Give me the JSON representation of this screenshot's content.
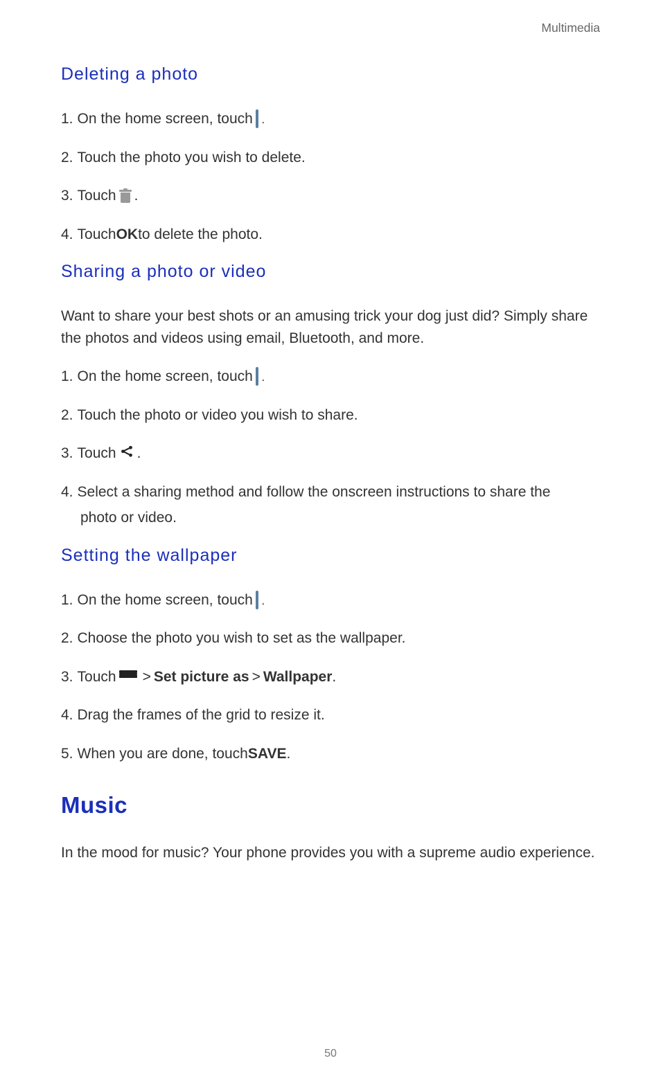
{
  "header": {
    "label": "Multimedia"
  },
  "section_delete": {
    "title": "Deleting  a  photo",
    "steps": [
      {
        "num": "1.",
        "pre": "On the home screen, touch",
        "icon": "gallery",
        "post": "."
      },
      {
        "num": "2.",
        "pre": "Touch the photo you wish to delete."
      },
      {
        "num": "3.",
        "pre": "Touch",
        "icon": "trash",
        "post": "."
      },
      {
        "num": "4.",
        "pre": "Touch ",
        "bold": "OK",
        "post": " to delete the photo."
      }
    ]
  },
  "section_share": {
    "title": "Sharing  a  photo  or  video",
    "intro": "Want to share your best shots or an amusing trick your dog just did? Simply share the photos and videos using email, Bluetooth, and more.",
    "steps": [
      {
        "num": "1.",
        "pre": "On the home screen, touch",
        "icon": "gallery",
        "post": "."
      },
      {
        "num": "2.",
        "pre": "Touch the photo or video you wish to share."
      },
      {
        "num": "3.",
        "pre": "Touch",
        "icon": "share",
        "post": "."
      },
      {
        "num": "4.",
        "pre": "Select a sharing method and follow the onscreen instructions to share the",
        "cont": "photo or video."
      }
    ]
  },
  "section_wallpaper": {
    "title": "Setting  the  wallpaper",
    "steps": [
      {
        "num": "1.",
        "pre": "On the home screen, touch",
        "icon": "gallery",
        "post": "."
      },
      {
        "num": "2.",
        "pre": "Choose the photo you wish to set as the wallpaper."
      },
      {
        "num": "3.",
        "pre": "Touch",
        "icon": "menu",
        "gt1": " > ",
        "bold1": "Set picture as",
        "gt2": " > ",
        "bold2": "Wallpaper",
        "post": "."
      },
      {
        "num": "4.",
        "pre": "Drag the frames of the grid to resize it."
      },
      {
        "num": "5.",
        "pre": "When you are done, touch ",
        "bold": "SAVE",
        "post": "."
      }
    ]
  },
  "section_music": {
    "title": "Music",
    "intro": "In the mood for music? Your phone provides you with a supreme audio experience."
  },
  "page_number": "50"
}
